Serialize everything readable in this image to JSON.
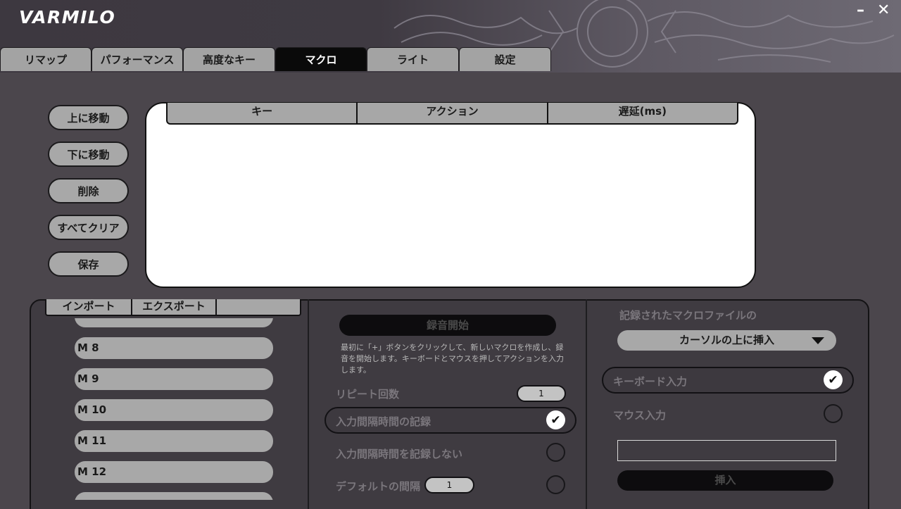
{
  "app": {
    "logo": "VARMILO",
    "minimize": "–",
    "close": "✕"
  },
  "tabs": [
    {
      "label": "リマップ"
    },
    {
      "label": "パフォーマンス"
    },
    {
      "label": "高度なキー"
    },
    {
      "label": "マクロ"
    },
    {
      "label": "ライト"
    },
    {
      "label": "設定"
    }
  ],
  "side_buttons": {
    "move_up": "上に移動",
    "move_down": "下に移動",
    "delete": "削除",
    "clear_all": "すべてクリア",
    "save": "保存"
  },
  "macro_table": {
    "columns": [
      "キー",
      "アクション",
      "遅延(ms)"
    ]
  },
  "macro_panel": {
    "import": "インポート",
    "export": "エクスポート",
    "items": [
      "M 8",
      "M 9",
      "M 10",
      "M 11",
      "M 12"
    ]
  },
  "recording": {
    "start_button": "録音開始",
    "hint": "最初に「+」ボタンをクリックして、新しいマクロを作成し、録音を開始します。キーボードとマウスを押してアクションを入力します。",
    "repeat_label": "リピート回数",
    "repeat_value": "1",
    "record_interval_label": "入力間隔時間の記録",
    "no_interval_label": "入力間隔時間を記録しない",
    "default_interval_label": "デフォルトの間隔",
    "default_interval_value": "1"
  },
  "insert_panel": {
    "title": "記録されたマクロファイルの",
    "dropdown_value": "カーソルの上に挿入",
    "keyboard_input": "キーボード入力",
    "mouse_input": "マウス入力",
    "text_value": "",
    "insert_button": "挿入"
  },
  "colors": {
    "accent_active_tab": "#0a0a0a",
    "button_gray": "#a8a8a8",
    "background": "#4b464c"
  },
  "icons": {
    "check": "check-icon",
    "dropdown": "triangle-down-icon"
  }
}
